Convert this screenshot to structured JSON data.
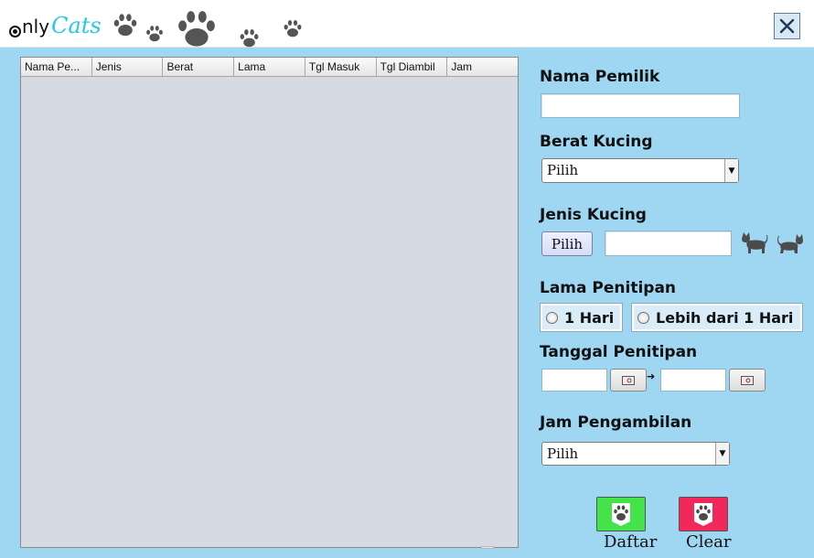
{
  "app": {
    "logo_prefix": "nly",
    "logo_suffix": "Cats",
    "accent": "#27c7e8"
  },
  "header": {
    "close_icon": "close-icon"
  },
  "table": {
    "columns": [
      "Nama Pe...",
      "Jenis",
      "Berat",
      "Lama",
      "Tgl Masuk",
      "Tgl Diambil",
      "Jam"
    ],
    "rows": []
  },
  "form": {
    "nama_pemilik": {
      "label": "Nama Pemilik",
      "value": ""
    },
    "berat_kucing": {
      "label": "Berat Kucing",
      "selected": "Pilih"
    },
    "jenis_kucing": {
      "label": "Jenis Kucing",
      "button": "Pilih",
      "value": ""
    },
    "lama_penitipan": {
      "label": "Lama Penitipan",
      "option1": "1 Hari",
      "option2": "Lebih dari 1 Hari"
    },
    "tanggal_penitipan": {
      "label": "Tanggal Penitipan",
      "start": "",
      "end": ""
    },
    "jam_pengambilan": {
      "label": "Jam Pengambilan",
      "selected": "Pilih"
    }
  },
  "actions": {
    "daftar": {
      "label": "Daftar",
      "color": "#44e34a"
    },
    "clear": {
      "label": "Clear",
      "color": "#f0285c"
    }
  }
}
